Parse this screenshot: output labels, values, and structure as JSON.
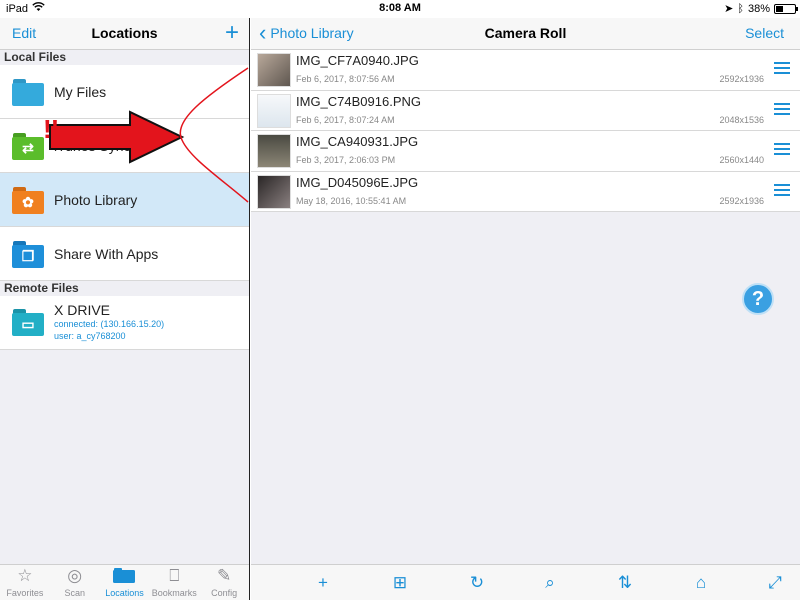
{
  "status": {
    "device": "iPad",
    "time": "8:08 AM",
    "battery": "38%",
    "battery_level": 0.38
  },
  "left": {
    "edit_label": "Edit",
    "title": "Locations",
    "add_label": "+",
    "sections": {
      "local": "Local Files",
      "remote": "Remote Files"
    },
    "local_items": [
      {
        "label": "My Files",
        "icon": "folder-icon",
        "color": "#34aadc"
      },
      {
        "label": "iTunes Sync",
        "icon": "itunes-sync-folder-icon",
        "color": "#5bbd2b"
      },
      {
        "label": "Photo Library",
        "icon": "photo-library-folder-icon",
        "color": "#f0801f"
      },
      {
        "label": "Share With Apps",
        "icon": "share-with-apps-folder-icon",
        "color": "#1e8fd9"
      }
    ],
    "remote_items": [
      {
        "label": "X DRIVE",
        "connected": "connected: (130.166.15.20)",
        "user": "user: a_cy768200",
        "icon": "network-drive-folder-icon"
      }
    ],
    "annotation": "!!",
    "tabs": [
      {
        "label": "Favorites",
        "icon": "star-icon",
        "glyph": "☆"
      },
      {
        "label": "Scan",
        "icon": "radar-icon",
        "glyph": "◎"
      },
      {
        "label": "Locations",
        "icon": "folder-icon",
        "glyph": "▬"
      },
      {
        "label": "Bookmarks",
        "icon": "book-icon",
        "glyph": "⎕"
      },
      {
        "label": "Config",
        "icon": "wrench-icon",
        "glyph": "✎"
      }
    ]
  },
  "right": {
    "back_label": "Photo Library",
    "title": "Camera Roll",
    "select_label": "Select",
    "files": [
      {
        "name": "IMG_CF7A0940.JPG",
        "date": "Feb 6, 2017, 8:07:56 AM",
        "res": "2592x1936",
        "thumb": "#8a7f73"
      },
      {
        "name": "IMG_C74B0916.PNG",
        "date": "Feb 6, 2017, 8:07:24 AM",
        "res": "2048x1536",
        "thumb": "#e8eef4"
      },
      {
        "name": "IMG_CA940931.JPG",
        "date": "Feb 3, 2017, 2:06:03 PM",
        "res": "2560x1440",
        "thumb": "#6f6a5e"
      },
      {
        "name": "IMG_D045096E.JPG",
        "date": "May 18, 2016, 10:55:41 AM",
        "res": "2592x1936",
        "thumb": "#3e3a3a"
      }
    ],
    "help_label": "?",
    "tools": [
      {
        "name": "add-tool",
        "glyph": "+"
      },
      {
        "name": "new-folder-tool",
        "glyph": "⊞"
      },
      {
        "name": "refresh-tool",
        "glyph": "↻"
      },
      {
        "name": "search-tool",
        "glyph": "⌕"
      },
      {
        "name": "sort-tool",
        "glyph": "⇅"
      },
      {
        "name": "home-tool",
        "glyph": "⌂"
      },
      {
        "name": "expand-tool",
        "glyph": "⤢"
      }
    ]
  }
}
